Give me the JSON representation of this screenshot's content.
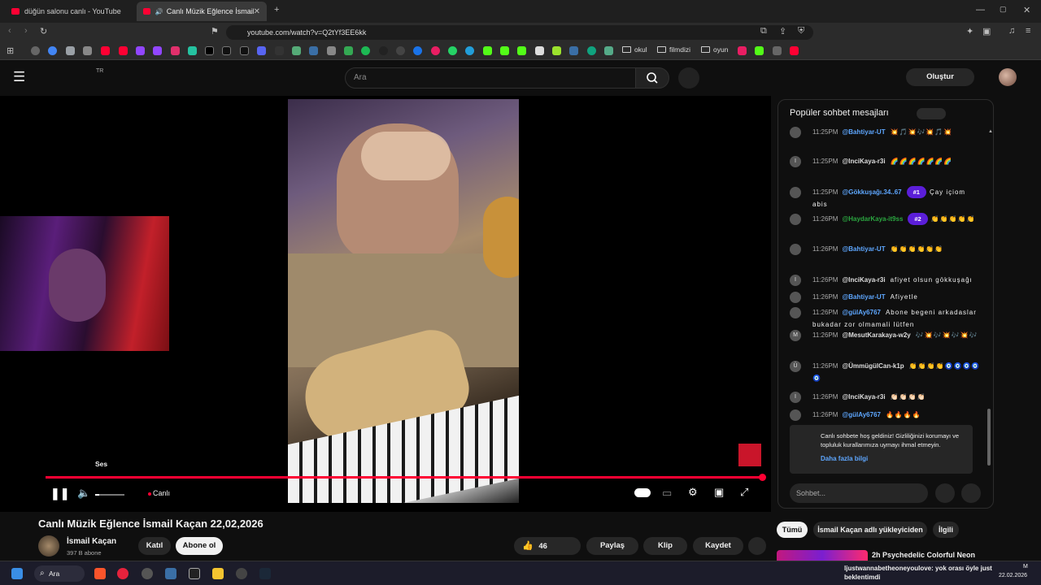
{
  "browser": {
    "tabs": [
      {
        "title": "düğün salonu canlı - YouTube"
      },
      {
        "title": "Canlı Müzik Eğlence İsmail Ka"
      }
    ],
    "url": "youtube.com/watch?v=Q2tYf3EE6kk",
    "bookmark_folders": [
      "okul",
      "filmdizi",
      "oyun"
    ]
  },
  "youtube": {
    "country": "TR",
    "search_placeholder": "Ara",
    "create_label": "Oluştur"
  },
  "player": {
    "volume_tooltip": "Ses",
    "live_label": "Canlı",
    "progress_fraction": 1.0,
    "volume_fraction": 0.15
  },
  "chat": {
    "header": "Popüler sohbet mesajları",
    "messages": [
      {
        "time": "11:25PM",
        "author": "@Bahtiyar-UT",
        "badge": "",
        "text": "💥🎵💥🎶💥🎵💥",
        "avatar": ""
      },
      {
        "time": "11:25PM",
        "author": "@InciKaya-r3i",
        "badge": "",
        "text": "🌈🌈🌈🌈🌈🌈🌈",
        "avatar": "I"
      },
      {
        "time": "11:25PM",
        "author": "@Gökkuşağı.34..67",
        "badge": "#1",
        "text": "Çay içiom abis",
        "avatar": ""
      },
      {
        "time": "11:26PM",
        "author": "@HaydarKaya-it9ss",
        "badge": "#2",
        "text": "👏👏👏👏👏",
        "avatar": ""
      },
      {
        "time": "11:26PM",
        "author": "@Bahtiyar-UT",
        "badge": "",
        "text": "👏👏👏👏👏👏",
        "avatar": ""
      },
      {
        "time": "11:26PM",
        "author": "@InciKaya-r3i",
        "badge": "",
        "text": "afiyet olsun gökkuşağı",
        "avatar": "I"
      },
      {
        "time": "11:26PM",
        "author": "@Bahtiyar-UT",
        "badge": "",
        "text": "Afiyetle",
        "avatar": ""
      },
      {
        "time": "11:26PM",
        "author": "@gülAy6767",
        "badge": "",
        "text": "Abone begeni arkadaslar bukadar zor olmamali lütfen",
        "avatar": ""
      },
      {
        "time": "11:26PM",
        "author": "@MesutKarakaya-w2y",
        "badge": "",
        "text": "🎶💥🎶💥🎶💥🎶",
        "avatar": "M"
      },
      {
        "time": "11:26PM",
        "author": "@ÜmmügülCan-k1p",
        "badge": "",
        "text": "👏👏👏👏🧿🧿🧿🧿🧿",
        "avatar": "Ü"
      },
      {
        "time": "11:26PM",
        "author": "@InciKaya-r3i",
        "badge": "",
        "text": "👏🏻👏🏻👏🏻👏🏻",
        "avatar": "I"
      },
      {
        "time": "11:26PM",
        "author": "@gülAy6767",
        "badge": "",
        "text": "🔥🔥🔥🔥",
        "avatar": ""
      }
    ],
    "notice": "Canlı sohbete hoş geldiniz! Gizliliğinizi korumayı ve topluluk kurallarımıza uymayı ihmal etmeyin.",
    "notice_link": "Daha fazla bilgi",
    "input_placeholder": "Sohbet..."
  },
  "video": {
    "title": "Canlı Müzik Eğlence İsmail Kaçan 22,02,2026",
    "channel": "İsmail Kaçan",
    "subscribers": "397 B abone",
    "join_label": "Katıl",
    "subscribe_label": "Abone ol",
    "likes": "46",
    "share_label": "Paylaş",
    "clip_label": "Klip",
    "save_label": "Kaydet"
  },
  "filters": [
    "Tümü",
    "İsmail Kaçan adlı yükleyiciden",
    "İlgili"
  ],
  "recommendation": {
    "title": "2h Psychedelic Colorful Neon"
  },
  "taskbar": {
    "search_label": "Ara",
    "notification": "ljustwannabetheoneyoulove: yok orası öyle just beklentimdi",
    "time": "M",
    "date": "22.02.2026"
  },
  "colors": {
    "accent": "#ff0033",
    "chat_badge": "#5b1ed9",
    "link": "#5ea7ff"
  }
}
